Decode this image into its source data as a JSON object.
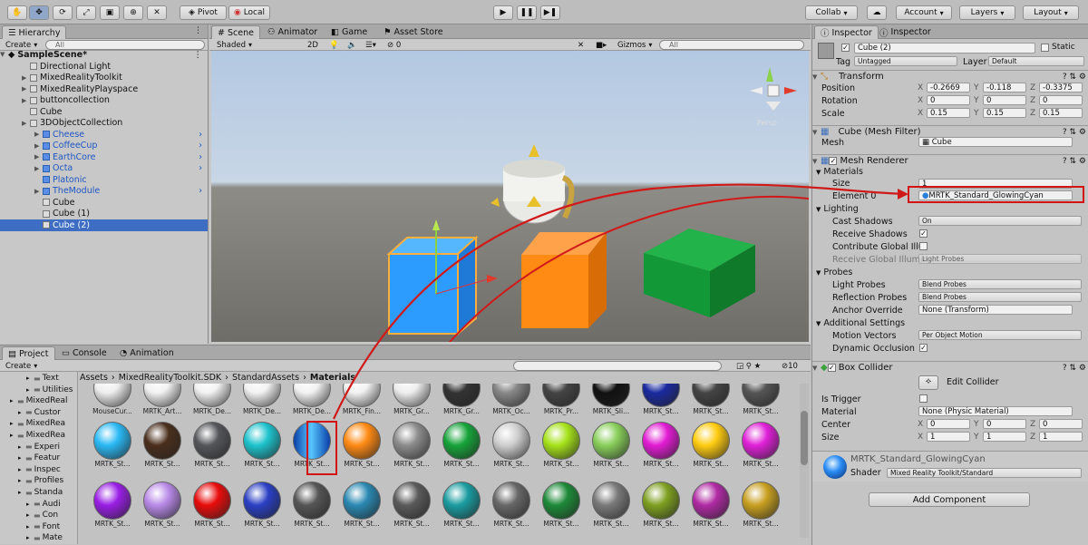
{
  "toolbar": {
    "pivot": "Pivot",
    "local": "Local",
    "collab": "Collab",
    "account": "Account",
    "layers": "Layers",
    "layout": "Layout"
  },
  "hierarchy": {
    "tab": "Hierarchy",
    "create": "Create",
    "search_placeholder": "All",
    "scene": "SampleScene*",
    "items": [
      {
        "label": "Directional Light",
        "indent": 1,
        "arrow": false,
        "prefab": false
      },
      {
        "label": "MixedRealityToolkit",
        "indent": 1,
        "arrow": true,
        "prefab": false
      },
      {
        "label": "MixedRealityPlayspace",
        "indent": 1,
        "arrow": true,
        "prefab": false
      },
      {
        "label": "buttoncollection",
        "indent": 1,
        "arrow": true,
        "prefab": false
      },
      {
        "label": "Cube",
        "indent": 1,
        "arrow": false,
        "prefab": false
      },
      {
        "label": "3DObjectCollection",
        "indent": 1,
        "arrow": true,
        "prefab": false
      },
      {
        "label": "Cheese",
        "indent": 2,
        "arrow": true,
        "prefab": true
      },
      {
        "label": "CoffeeCup",
        "indent": 2,
        "arrow": true,
        "prefab": true
      },
      {
        "label": "EarthCore",
        "indent": 2,
        "arrow": true,
        "prefab": true
      },
      {
        "label": "Octa",
        "indent": 2,
        "arrow": true,
        "prefab": true
      },
      {
        "label": "Platonic",
        "indent": 2,
        "arrow": false,
        "prefab": true
      },
      {
        "label": "TheModule",
        "indent": 2,
        "arrow": true,
        "prefab": true
      },
      {
        "label": "Cube",
        "indent": 2,
        "arrow": false,
        "prefab": false
      },
      {
        "label": "Cube (1)",
        "indent": 2,
        "arrow": false,
        "prefab": false
      },
      {
        "label": "Cube (2)",
        "indent": 2,
        "arrow": false,
        "prefab": false,
        "selected": true
      }
    ]
  },
  "scene": {
    "tabs": [
      "Scene",
      "Animator",
      "Game",
      "Asset Store"
    ],
    "shading": "Shaded",
    "mode2d": "2D",
    "fx_count": "0",
    "gizmos": "Gizmos",
    "search_placeholder": "All",
    "persp": "Persp"
  },
  "project": {
    "tabs": [
      "Project",
      "Console",
      "Animation"
    ],
    "create": "Create",
    "breadcrumb": [
      "Assets",
      "MixedRealityToolkit.SDK",
      "StandardAssets",
      "Materials"
    ],
    "count": "10",
    "folders": [
      "Text",
      "Utilities",
      "MixedReal",
      "Custor",
      "MixedRea",
      "MixedRea",
      "Experi",
      "Featur",
      "Inspec",
      "Profiles",
      "Standa",
      "Audi",
      "Con",
      "Font",
      "Mate"
    ],
    "row0_labels": [
      "MouseCur...",
      "MRTK_Art...",
      "MRTK_De...",
      "MRTK_De...",
      "MRTK_De...",
      "MRTK_Fin...",
      "MRTK_Gr...",
      "MRTK_Gr...",
      "MRTK_Oc...",
      "MRTK_Pr...",
      "MRTK_Sli...",
      "MRTK_St...",
      "MRTK_St...",
      "MRTK_St..."
    ],
    "row1_labels": [
      "MRTK_St...",
      "MRTK_St...",
      "MRTK_St...",
      "MRTK_St...",
      "MRTK_St...",
      "MRTK_St...",
      "MRTK_St...",
      "MRTK_St...",
      "MRTK_St...",
      "MRTK_St...",
      "MRTK_St...",
      "MRTK_St...",
      "MRTK_St...",
      "MRTK_St..."
    ],
    "row2_labels": [
      "MRTK_St...",
      "MRTK_St...",
      "MRTK_St...",
      "MRTK_St...",
      "MRTK_St...",
      "MRTK_St...",
      "MRTK_St...",
      "MRTK_St...",
      "MRTK_St...",
      "MRTK_St...",
      "MRTK_St...",
      "MRTK_St...",
      "MRTK_St...",
      "MRTK_St..."
    ]
  },
  "inspector": {
    "tabs": [
      "Inspector",
      "Inspector"
    ],
    "object_name": "Cube (2)",
    "static": "Static",
    "tag_label": "Tag",
    "tag": "Untagged",
    "layer_label": "Layer",
    "layer": "Default",
    "transform": {
      "title": "Transform",
      "position": {
        "label": "Position",
        "x": "-0.2669",
        "y": "-0.118",
        "z": "-0.3375"
      },
      "rotation": {
        "label": "Rotation",
        "x": "0",
        "y": "0",
        "z": "0"
      },
      "scale": {
        "label": "Scale",
        "x": "0.15",
        "y": "0.15",
        "z": "0.15"
      }
    },
    "mesh_filter": {
      "title": "Cube (Mesh Filter)",
      "mesh_label": "Mesh",
      "mesh": "Cube"
    },
    "mesh_renderer": {
      "title": "Mesh Renderer",
      "materials": "Materials",
      "size_label": "Size",
      "size": "1",
      "element_label": "Element 0",
      "element": "MRTK_Standard_GlowingCyan",
      "lighting": "Lighting",
      "cast_label": "Cast Shadows",
      "cast": "On",
      "receive_label": "Receive Shadows",
      "contribute_label": "Contribute Global Illur",
      "receive_gi_label": "Receive Global Illumin",
      "receive_gi": "Light Probes",
      "probes": "Probes",
      "light_probes_label": "Light Probes",
      "light_probes": "Blend Probes",
      "reflection_label": "Reflection Probes",
      "reflection": "Blend Probes",
      "anchor_label": "Anchor Override",
      "anchor": "None (Transform)",
      "additional": "Additional Settings",
      "motion_label": "Motion Vectors",
      "motion": "Per Object Motion",
      "dynamic_label": "Dynamic Occlusion"
    },
    "box_collider": {
      "title": "Box Collider",
      "edit": "Edit Collider",
      "trigger_label": "Is Trigger",
      "material_label": "Material",
      "material": "None (Physic Material)",
      "center_label": "Center",
      "cx": "0",
      "cy": "0",
      "cz": "0",
      "size_label": "Size",
      "sx": "1",
      "sy": "1",
      "sz": "1"
    },
    "material": {
      "name": "MRTK_Standard_GlowingCyan",
      "shader_label": "Shader",
      "shader": "Mixed Reality Toolkit/Standard"
    },
    "add_component": "Add Component"
  }
}
